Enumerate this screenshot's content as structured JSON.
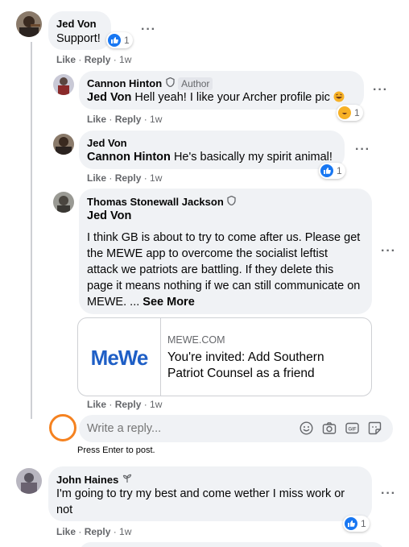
{
  "comments": [
    {
      "author": "Jed Von",
      "text": "Support!",
      "reaction_count": "1",
      "actions": {
        "like": "Like",
        "reply": "Reply",
        "time": "1w"
      }
    },
    {
      "author": "Cannon Hinton",
      "author_badge": "Author",
      "tag": "Jed Von",
      "text": "Hell yeah! I like your Archer profile pic",
      "reaction_count": "1",
      "actions": {
        "like": "Like",
        "reply": "Reply",
        "time": "1w"
      }
    },
    {
      "author": "Jed Von",
      "tag": "Cannon Hinton",
      "text": "He's basically my spirit animal!",
      "reaction_count": "1",
      "actions": {
        "like": "Like",
        "reply": "Reply",
        "time": "1w"
      }
    },
    {
      "author": "Thomas Stonewall Jackson",
      "tag": "Jed Von",
      "text": "I think GB is about to try to come after us. Please get the MEWE app to overcome the socialist leftist attack we patriots are battling. If they delete this page it means nothing if we can still communicate on MEWE. ...",
      "see_more": "See More",
      "link": {
        "logo": "MeWe",
        "domain": "MEWE.COM",
        "title": "You're invited: Add Southern Patriot Counsel as a friend"
      },
      "actions": {
        "like": "Like",
        "reply": "Reply",
        "time": "1w"
      }
    },
    {
      "author": "John Haines",
      "text": "I'm going to try my best and come wether I miss work or not",
      "reaction_count": "1",
      "actions": {
        "like": "Like",
        "reply": "Reply",
        "time": "1w"
      }
    }
  ],
  "reply_box": {
    "placeholder": "Write a reply...",
    "hint": "Press Enter to post."
  },
  "colors": {
    "bubble": "#f0f2f5",
    "like_blue": "#1877f2",
    "highlight_circle": "#f58220",
    "meta_gray": "#65676b"
  }
}
